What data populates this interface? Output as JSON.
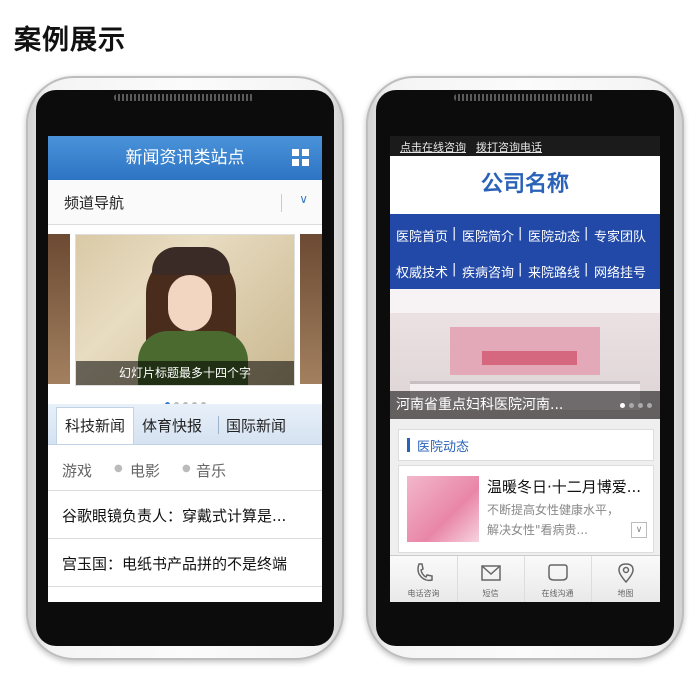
{
  "page": {
    "heading": "案例展示"
  },
  "left": {
    "header_title": "新闻资讯类站点",
    "channel_nav": "频道导航",
    "slide_caption": "幻灯片标题最多十四个字",
    "tabs": [
      "科技新闻",
      "体育快报",
      "国际新闻"
    ],
    "categories": [
      "游戏",
      "电影",
      "音乐"
    ],
    "news": [
      "谷歌眼镜负责人：穿戴式计算是...",
      "宫玉国：电纸书产品拼的不是终端"
    ]
  },
  "right": {
    "top_links": [
      "点击在线咨询",
      "拨打咨询电话"
    ],
    "logo": "公司名称",
    "menu_row1": [
      "医院首页",
      "医院简介",
      "医院动态",
      "专家团队"
    ],
    "menu_row2": [
      "权威技术",
      "疾病咨询",
      "来院路线",
      "网络挂号"
    ],
    "banner_caption": "河南省重点妇科医院河南...",
    "section_title": "医院动态",
    "card_title": "温暖冬日·十二月博爱...",
    "card_line1": "不断提高女性健康水平，",
    "card_line2": "解决女性\"看病贵...",
    "footer": [
      "电话咨询",
      "短信",
      "在线沟通",
      "地图"
    ]
  }
}
